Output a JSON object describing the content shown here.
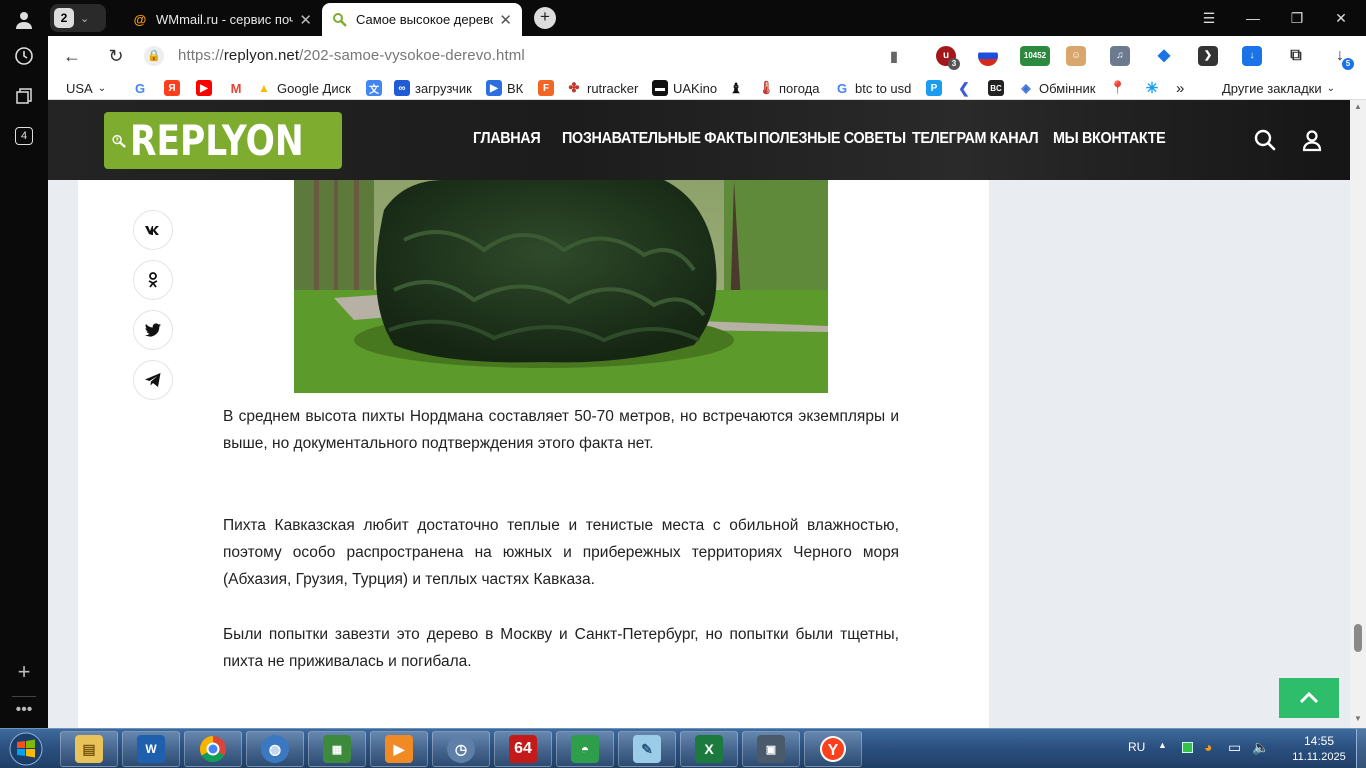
{
  "browser": {
    "tab_count": "2",
    "tabs": [
      {
        "title": "WMmail.ru - сервис почто",
        "active": false
      },
      {
        "title": "Самое высокое дерево",
        "active": true
      }
    ],
    "url_scheme": "https://",
    "url_host": "replyon.net",
    "url_path": "/202-samoe-vysokoe-derevo.html",
    "extension_badges": {
      "ublock": "3",
      "counter": "10452",
      "download": "5"
    },
    "sidebar_badge": "4"
  },
  "bookmarks": {
    "region": "USA",
    "items": [
      "Google Диск",
      "загрузчик",
      "ВК",
      "rutracker",
      "UAKino",
      "погода",
      "btc to usd",
      "Обмінник"
    ],
    "other": "Другие закладки"
  },
  "site": {
    "logo": "REPLYON",
    "nav": [
      "ГЛАВНАЯ",
      "ПОЗНАВАТЕЛЬНЫЕ ФАКТЫ",
      "ПОЛЕЗНЫЕ СОВЕТЫ",
      "ТЕЛЕГРАМ КАНАЛ",
      "МЫ ВКОНТАКТЕ"
    ]
  },
  "share": [
    "vk",
    "ok",
    "twitter",
    "telegram"
  ],
  "article": {
    "paragraphs": [
      "В среднем высота пихты Нордмана составляет 50-70 метров, но встречаются экземпляры и выше, но документального подтверждения этого факта нет.",
      "Пихта Кавказская любит достаточно теплые и тенистые места с обильной влажностью, поэтому особо распространена на южных и прибережных территориях Черного моря (Абхазия, Грузия, Турция) и теплых частях Кавказа.",
      "Были попытки завезти это дерево в Москву и Санкт-Петербург, но попытки были тщетны, пихта не приживалась и погибала."
    ]
  },
  "taskbar": {
    "items": [
      "explorer",
      "wise-care",
      "chrome",
      "network",
      "task-manager",
      "media-player",
      "clock-app",
      "aida64",
      "file-app",
      "notes",
      "excel",
      "terminal",
      "yandex"
    ],
    "aida_label": "64"
  },
  "tray": {
    "lang": "RU",
    "time": "14:55",
    "date": "11.11.2025"
  },
  "colors": {
    "accent_green": "#7dac2f",
    "scroll_top_green": "#2ebd6b",
    "taskbar": "#2a4f7e"
  }
}
